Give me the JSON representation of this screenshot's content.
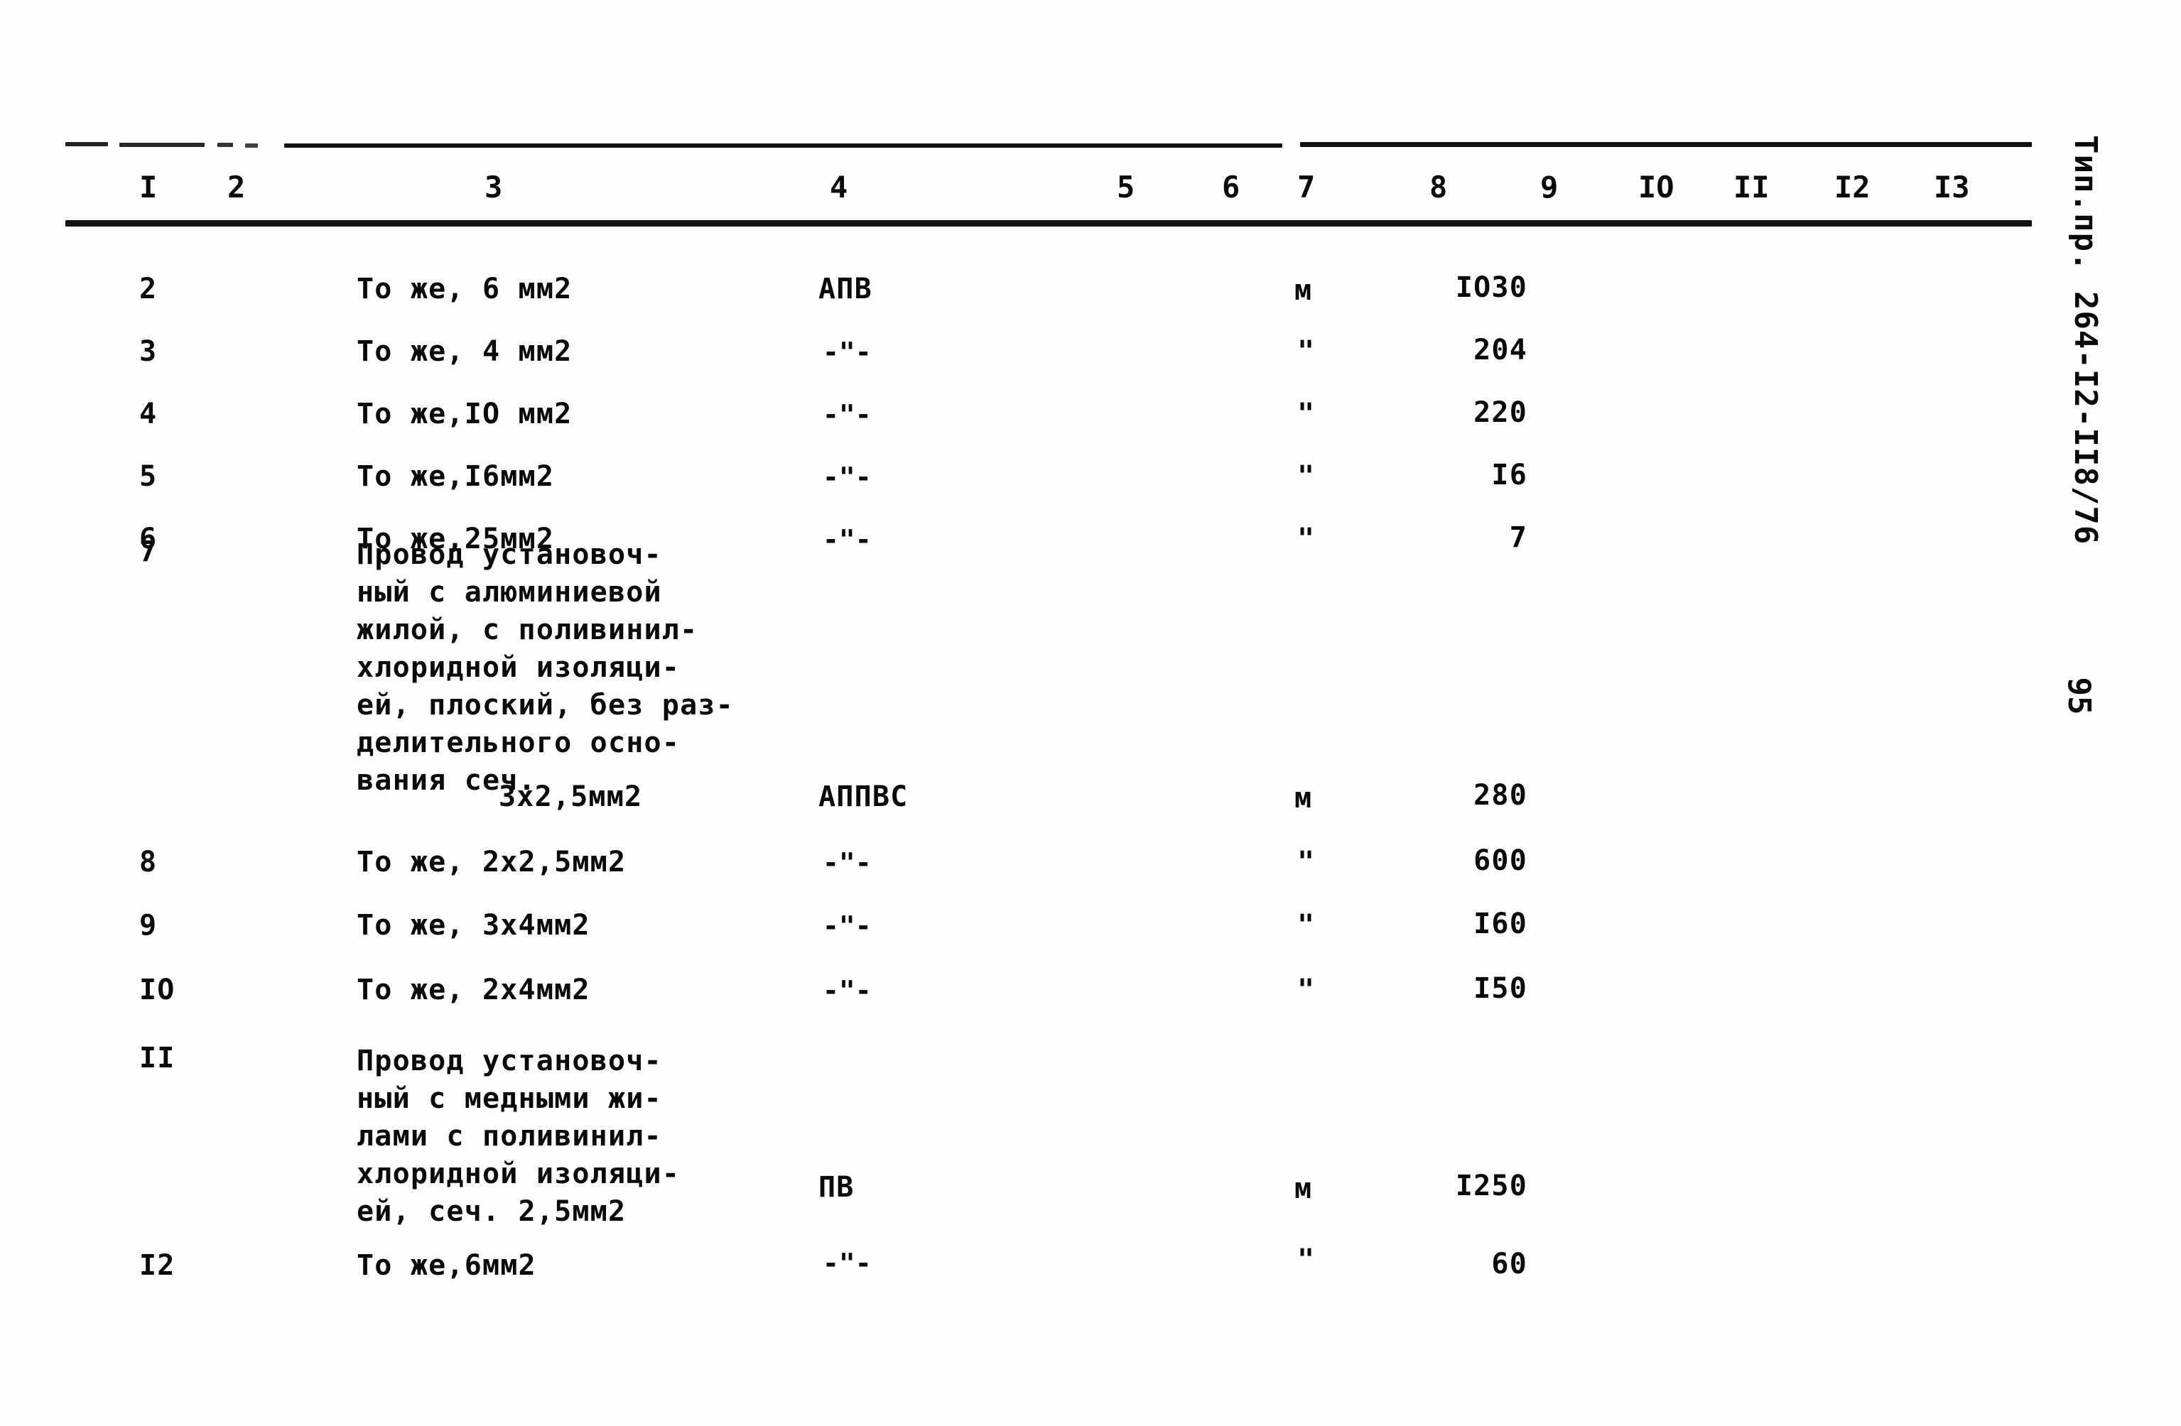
{
  "document": {
    "type": "scanned-typewritten-table",
    "side_stamp": "Тип.пр. 264-I2-II8/76",
    "page_number": "95"
  },
  "table": {
    "column_headers": [
      "I",
      "2",
      "3",
      "4",
      "5",
      "6",
      "7",
      "8",
      "9",
      "IO",
      "II",
      "I2",
      "I3"
    ],
    "rows": [
      {
        "c1": "2",
        "c3": "То же, 6 мм2",
        "c4": "АПВ",
        "c7": "м",
        "c8": "IO30"
      },
      {
        "c1": "3",
        "c3": "То же, 4 мм2",
        "c4": "-\"-",
        "c7": "\"",
        "c8": "204"
      },
      {
        "c1": "4",
        "c3": "То же,IO мм2",
        "c4": "-\"-",
        "c7": "\"",
        "c8": "220"
      },
      {
        "c1": "5",
        "c3": "То же,I6мм2",
        "c4": "-\"-",
        "c7": "\"",
        "c8": "I6"
      },
      {
        "c1": "6",
        "c3": "То же,25мм2",
        "c4": "-\"-",
        "c7": "\"",
        "c8": "7"
      },
      {
        "c1": "7",
        "c3": "Провод установоч-\nный с алюминиевой\nжилой, с поливинил-\nхлоридной изоляци-\nей, плоский, без раз-\nделительного осно-\nвания сеч.",
        "c3b": "3х2,5мм2",
        "c4": "АППВС",
        "c7": "м",
        "c8": "280"
      },
      {
        "c1": "8",
        "c3": "То же, 2х2,5мм2",
        "c4": "-\"-",
        "c7": "\"",
        "c8": "600"
      },
      {
        "c1": "9",
        "c3": "То же, 3х4мм2",
        "c4": "-\"-",
        "c7": "\"",
        "c8": "I60"
      },
      {
        "c1": "IO",
        "c3": "То же, 2х4мм2",
        "c4": "-\"-",
        "c7": "\"",
        "c8": "I50"
      },
      {
        "c1": "II",
        "c3": "Провод установоч-\nный с медными жи-\nлами с поливинил-\nхлоридной изоляци-\nей, сеч. 2,5мм2",
        "c4": "ПВ",
        "c7": "м",
        "c8": "I250"
      },
      {
        "c1": "I2",
        "c3": "То же,6мм2",
        "c4": "-\"-",
        "c7": "\"",
        "c8": "60"
      }
    ]
  }
}
